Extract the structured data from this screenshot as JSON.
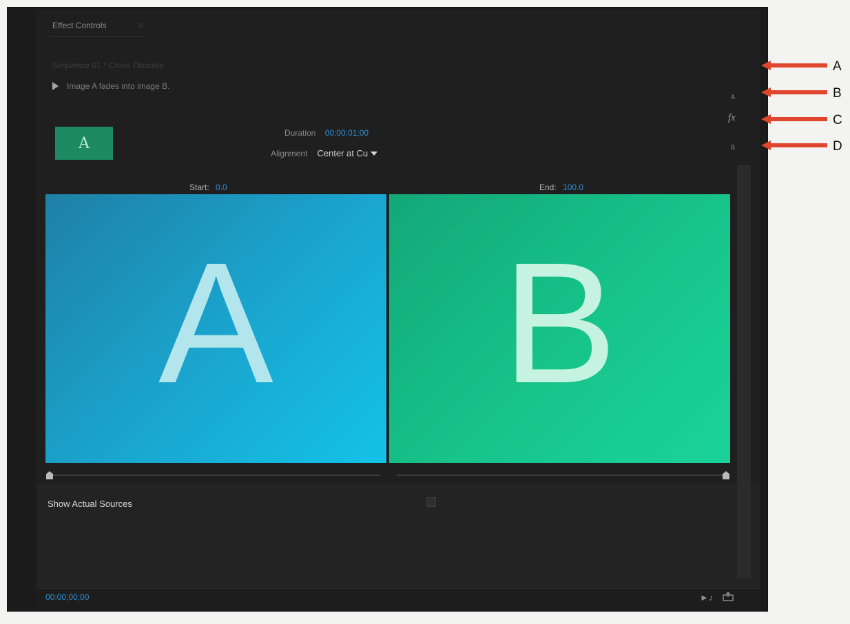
{
  "panel": {
    "title": "Effect Controls",
    "menu_icon": "≡",
    "sequence_label": "Sequence 01 * Cross Dissolve",
    "description": "Image A fades into image B.",
    "track_a": "A",
    "fx": "fx",
    "track_b": "B",
    "thumbnail_letter": "A"
  },
  "transition": {
    "duration_label": "Duration",
    "duration_value": "00;00;01;00",
    "alignment_label": "Alignment",
    "alignment_value": "Center at Cu",
    "start_label": "Start:",
    "start_value": "0.0",
    "end_label": "End:",
    "end_value": "100.0"
  },
  "preview": {
    "a_letter": "A",
    "b_letter": "B",
    "a_color": "#1aa3cc",
    "b_color": "#17c48a"
  },
  "options": {
    "show_actual_sources_label": "Show Actual Sources",
    "show_actual_sources_checked": false
  },
  "footer": {
    "timecode": "00;00;00;00",
    "play_icon": "►♪"
  },
  "annotations": [
    "A",
    "B",
    "C",
    "D"
  ]
}
